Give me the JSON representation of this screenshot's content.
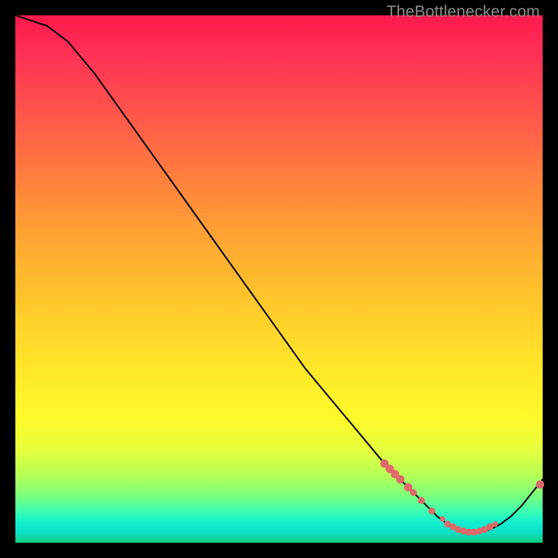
{
  "watermark": "TheBottlenecker.com",
  "colors": {
    "marker_fill": "#e06a6a",
    "marker_stroke": "#c94f4f",
    "curve": "#000000"
  },
  "chart_data": {
    "type": "line",
    "title": "",
    "xlabel": "",
    "ylabel": "",
    "xlim": [
      0,
      100
    ],
    "ylim": [
      0,
      100
    ],
    "series": [
      {
        "name": "curve",
        "x": [
          0,
          3,
          6,
          10,
          15,
          20,
          25,
          30,
          35,
          40,
          45,
          50,
          55,
          60,
          65,
          70,
          72,
          74,
          76,
          78,
          80,
          82,
          84,
          86,
          88,
          90,
          92,
          94,
          96,
          98,
          100
        ],
        "y": [
          100,
          99,
          98,
          95,
          89,
          82,
          75,
          68,
          61,
          54,
          47,
          40,
          33,
          27,
          21,
          15,
          13,
          11,
          9,
          7,
          5,
          3.5,
          2.5,
          2,
          2,
          2.5,
          3.5,
          5,
          7,
          9.5,
          12
        ]
      }
    ],
    "markers": [
      {
        "x": 70,
        "y": 15,
        "r": 6
      },
      {
        "x": 71,
        "y": 14,
        "r": 6
      },
      {
        "x": 72,
        "y": 13,
        "r": 6
      },
      {
        "x": 73,
        "y": 12,
        "r": 6
      },
      {
        "x": 74.5,
        "y": 10.5,
        "r": 6
      },
      {
        "x": 75.5,
        "y": 9.5,
        "r": 5
      },
      {
        "x": 77,
        "y": 8,
        "r": 5
      },
      {
        "x": 79,
        "y": 6,
        "r": 5
      },
      {
        "x": 81,
        "y": 4.5,
        "r": 4
      },
      {
        "x": 82,
        "y": 3.5,
        "r": 5
      },
      {
        "x": 83,
        "y": 3,
        "r": 5
      },
      {
        "x": 84,
        "y": 2.5,
        "r": 5
      },
      {
        "x": 85,
        "y": 2.2,
        "r": 5
      },
      {
        "x": 86,
        "y": 2,
        "r": 5
      },
      {
        "x": 87,
        "y": 2,
        "r": 5
      },
      {
        "x": 88,
        "y": 2.2,
        "r": 5
      },
      {
        "x": 89,
        "y": 2.5,
        "r": 5
      },
      {
        "x": 90,
        "y": 3,
        "r": 5
      },
      {
        "x": 91,
        "y": 3.5,
        "r": 4
      },
      {
        "x": 99.5,
        "y": 11,
        "r": 6
      }
    ]
  }
}
